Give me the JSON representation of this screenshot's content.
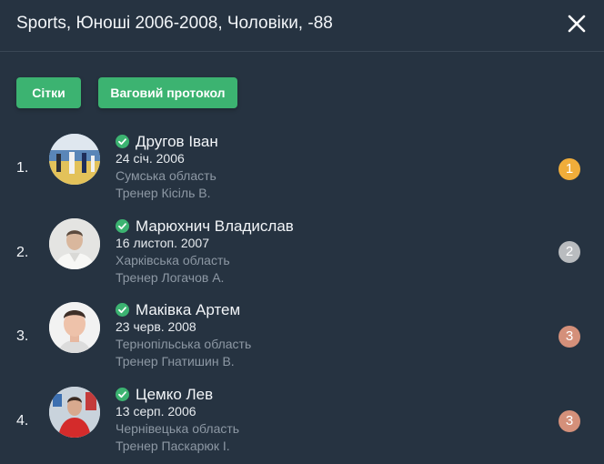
{
  "header": {
    "title": "Sports, Юноші 2006-2008, Чоловіки, -88",
    "close_icon": "close-icon"
  },
  "toolbar": {
    "grids_label": "Сітки",
    "weigh_label": "Ваговий протокол",
    "accent_color": "#3cb371"
  },
  "athletes": [
    {
      "rank": "1.",
      "name": "Другов Іван",
      "dob": "24 січ. 2006",
      "region": "Сумська область",
      "coach": "Тренер Кісіль В.",
      "place": "1",
      "medal_color": "#f0ad3a",
      "verified_icon": "check-circle-icon"
    },
    {
      "rank": "2.",
      "name": "Марюхнич Владислав",
      "dob": "16 листоп. 2007",
      "region": "Харківська область",
      "coach": "Тренер Логачов А.",
      "place": "2",
      "medal_color": "#b9bcbf",
      "verified_icon": "check-circle-icon"
    },
    {
      "rank": "3.",
      "name": "Маківка Артем",
      "dob": "23 черв. 2008",
      "region": "Тернопільська область",
      "coach": "Тренер Гнатишин В.",
      "place": "3",
      "medal_color": "#d4907a",
      "verified_icon": "check-circle-icon"
    },
    {
      "rank": "4.",
      "name": "Цемко Лев",
      "dob": "13 серп. 2006",
      "region": "Чернівецька область",
      "coach": "Тренер Паскарюк І.",
      "place": "3",
      "medal_color": "#d4907a",
      "verified_icon": "check-circle-icon"
    }
  ]
}
